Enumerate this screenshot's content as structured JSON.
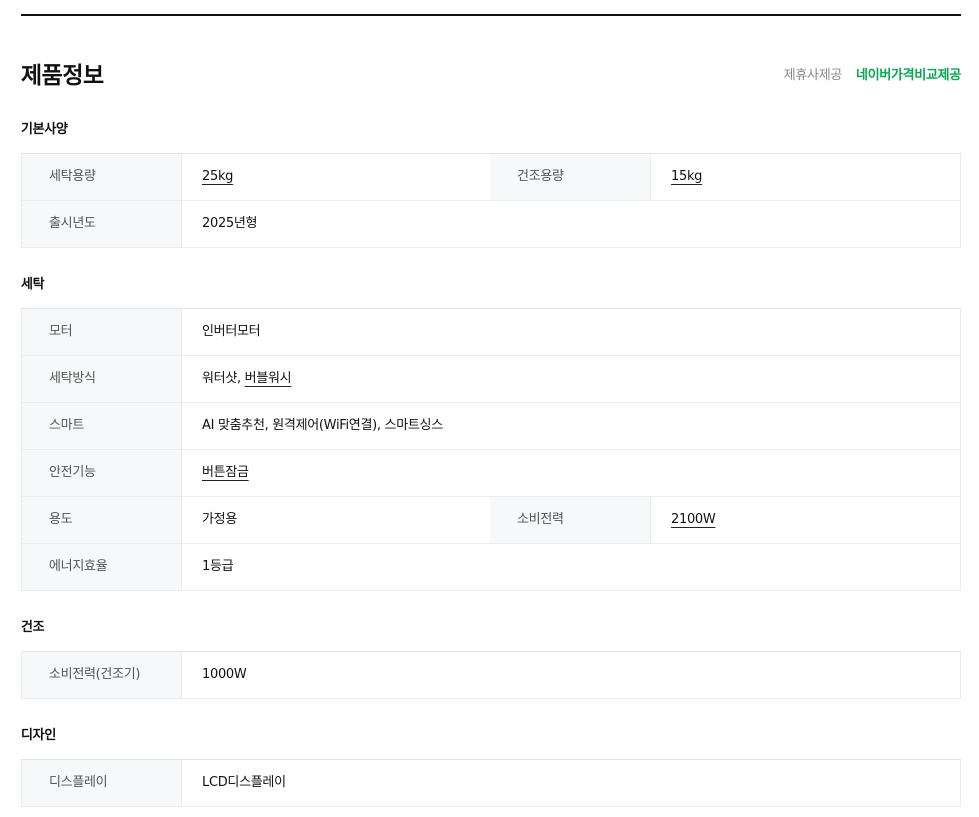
{
  "header": {
    "title": "제품정보",
    "provider_affiliate": "제휴사제공",
    "provider_naver": "네이버가격비교제공"
  },
  "sections": {
    "basic": {
      "title": "기본사양",
      "rows": [
        {
          "label": "세탁용량",
          "value": "25kg",
          "label2": "건조용량",
          "value2": "15kg"
        },
        {
          "label": "출시년도",
          "value": "2025년형"
        }
      ]
    },
    "wash": {
      "title": "세탁",
      "rows": [
        {
          "label": "모터",
          "value": "인버터모터"
        },
        {
          "label": "세탁방식",
          "value_a": "워터샷, ",
          "value_b": "버블워시"
        },
        {
          "label": "스마트",
          "value": "AI 맞춤추천, 원격제어(WiFi연결), 스마트싱스"
        },
        {
          "label": "안전기능",
          "value": "버튼잠금"
        },
        {
          "label": "용도",
          "value": "가정용",
          "label2": "소비전력",
          "value2": "2100W"
        },
        {
          "label": "에너지효율",
          "value": "1등급"
        }
      ]
    },
    "dry": {
      "title": "건조",
      "rows": [
        {
          "label": "소비전력(건조기)",
          "value": "1000W"
        }
      ]
    },
    "design": {
      "title": "디자인",
      "rows": [
        {
          "label": "디스플레이",
          "value": "LCD디스플레이"
        }
      ]
    }
  }
}
